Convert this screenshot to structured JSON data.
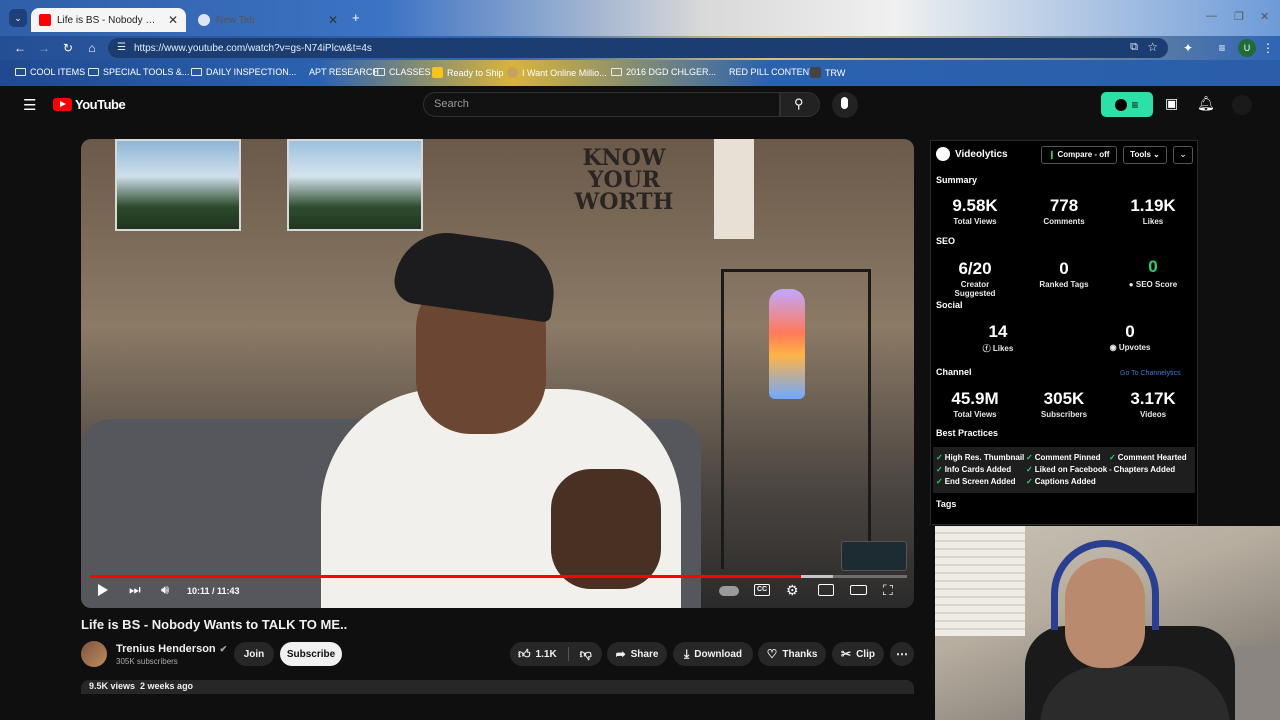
{
  "browser": {
    "tabs": [
      {
        "title": "Life is BS - Nobody Wants to TALK TO ME..",
        "active": true
      },
      {
        "title": "New Tab",
        "active": false
      }
    ],
    "url": "https://www.youtube.com/watch?v=gs-N74iPlcw&t=4s",
    "profile_initial": "U",
    "bookmarks": [
      "COOL ITEMS",
      "SPECIAL TOOLS &...",
      "DAILY INSPECTION...",
      "APT RESEARCH",
      "CLASSES",
      "Ready to Ship",
      "I Want Online Millio...",
      "2016 DGD CHLGER...",
      "RED PILL CONTENT",
      "TRW"
    ]
  },
  "youtube": {
    "logo_text": "YouTube",
    "search_placeholder": "Search",
    "video": {
      "time_current": "10:11",
      "time_total": "11:43",
      "time_display": "10:11 / 11:43",
      "progress_fraction": 0.87,
      "buffer_fraction": 0.91,
      "wall_sign": [
        "KNOW",
        "YOUR",
        "WORTH"
      ]
    },
    "title": "Life is BS - Nobody Wants to TALK TO ME..",
    "channel": {
      "name": "Trenius Henderson",
      "subscribers": "305K subscribers"
    },
    "buttons": {
      "join": "Join",
      "subscribe": "Subscribe",
      "likes": "1.1K",
      "share": "Share",
      "download": "Download",
      "thanks": "Thanks",
      "clip": "Clip"
    },
    "views_line": "9.5K views  2 weeks ago"
  },
  "videolytics": {
    "brand": "Videolytics",
    "compare_label": "Compare - off",
    "tools_label": "Tools",
    "summary_title": "Summary",
    "summary": [
      {
        "value": "9.58K",
        "label": "Total Views"
      },
      {
        "value": "778",
        "label": "Comments"
      },
      {
        "value": "1.19K",
        "label": "Likes"
      }
    ],
    "seo_title": "SEO",
    "seo": [
      {
        "value": "6/20",
        "label": "Creator Suggested"
      },
      {
        "value": "0",
        "label": "Ranked Tags"
      },
      {
        "value": "0",
        "label": "SEO Score"
      }
    ],
    "social_title": "Social",
    "social": [
      {
        "value": "14",
        "label": "Likes"
      },
      {
        "value": "0",
        "label": "Upvotes"
      }
    ],
    "channel_title": "Channel",
    "channel_link": "Go To Channelytics",
    "channel_stats": [
      {
        "value": "45.9M",
        "label": "Total Views"
      },
      {
        "value": "305K",
        "label": "Subscribers"
      },
      {
        "value": "3.17K",
        "label": "Videos"
      }
    ],
    "best_practices_title": "Best Practices",
    "best_practices": [
      {
        "label": "High Res. Thumbnail",
        "status": "check"
      },
      {
        "label": "Comment Pinned",
        "status": "check"
      },
      {
        "label": "Comment Hearted",
        "status": "check"
      },
      {
        "label": "Info Cards Added",
        "status": "check"
      },
      {
        "label": "Liked on Facebook",
        "status": "check"
      },
      {
        "label": "Chapters Added",
        "status": "dash"
      },
      {
        "label": "End Screen Added",
        "status": "check"
      },
      {
        "label": "Captions Added",
        "status": "check"
      }
    ],
    "tags_title": "Tags",
    "accent": "#2bd46a"
  }
}
